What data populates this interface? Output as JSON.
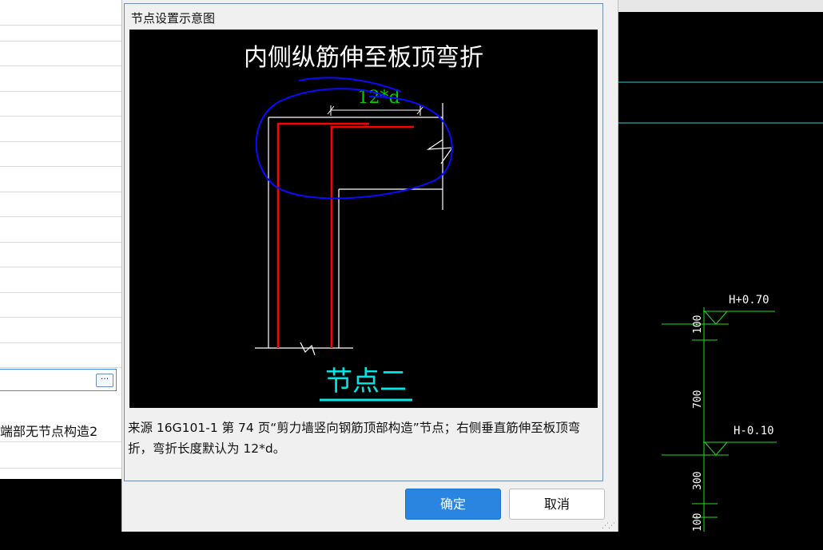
{
  "dialog": {
    "group_title": "节点设置示意图",
    "description": "来源 16G101-1 第 74 页“剪力墙竖向钢筋顶部构造”节点；右侧垂直筋伸至板顶弯折，弯折长度默认为 12*d。",
    "ok_label": "确定",
    "cancel_label": "取消"
  },
  "diagram": {
    "title": "内侧纵筋伸至板顶弯折",
    "dimension_label": "12*d",
    "node_name": "节点二"
  },
  "left_panel": {
    "visible_row_text": "端部无节点构造2",
    "ellipsis_label": "···"
  },
  "cad": {
    "upper_level_label": "H+0.70",
    "lower_level_label": "H-0.10",
    "dim_top": "100",
    "dim_middle": "700",
    "dim_lower": "300",
    "dim_bottom": "100"
  },
  "colors": {
    "accent": "#2a85e0",
    "rebar": "#ff0000",
    "annotation": "#0000ff",
    "node_label": "#00e5e5",
    "dimension": "#00cc00"
  }
}
